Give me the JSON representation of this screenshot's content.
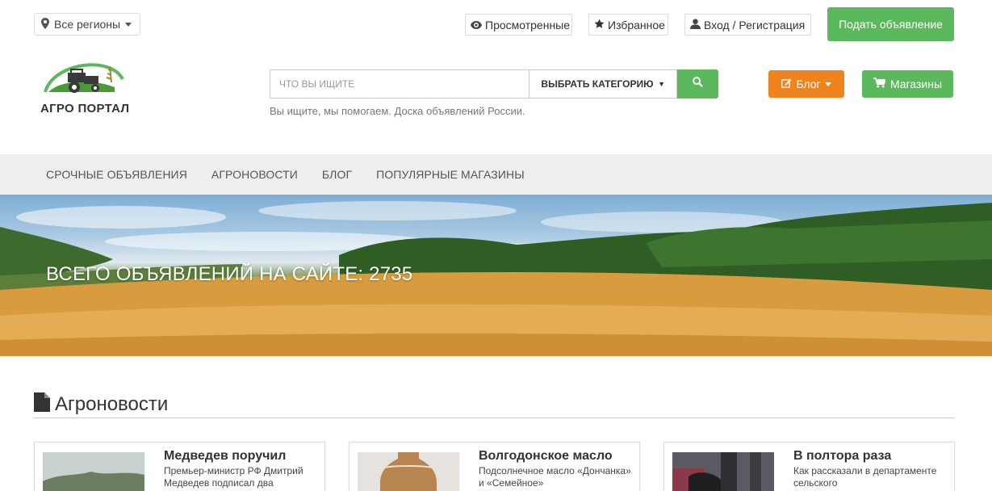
{
  "topbar": {
    "region_label": "Все регионы",
    "viewed_label": "Просмотренные",
    "favorites_label": "Избранное",
    "login_label": "Вход / Регистрация",
    "submit_ad_label": "Подать объявление"
  },
  "logo": {
    "text": "АГРО ПОРТАЛ"
  },
  "search": {
    "placeholder": "ЧТО ВЫ ИЩИТЕ",
    "category_label": "ВЫБРАТЬ КАТЕГОРИЮ",
    "tagline": "Вы ищите, мы помогаем. Доска объявлений России."
  },
  "buttons": {
    "blog_label": "Блог",
    "shops_label": "Магазины"
  },
  "nav": {
    "items": [
      {
        "label": "СРОЧНЫЕ ОБЪЯВЛЕНИЯ"
      },
      {
        "label": "АГРОНОВОСТИ"
      },
      {
        "label": "БЛОГ"
      },
      {
        "label": "ПОПУЛЯРНЫЕ МАГАЗИНЫ"
      }
    ]
  },
  "hero": {
    "title": "ВСЕГО ОБЪЯВЛЕНИЙ НА САЙТЕ: 2735"
  },
  "news": {
    "heading": "Агроновости",
    "cards": [
      {
        "title": "Медведев поручил",
        "excerpt": "Премьер-министр РФ Дмитрий Медведев подписал два"
      },
      {
        "title": "Волгодонское масло",
        "excerpt": "Подсолнечное масло «Дончанка» и «Семейное»"
      },
      {
        "title": "В полтора раза",
        "excerpt": "Как рассказали в департаменте сельского"
      }
    ]
  },
  "colors": {
    "green": "#5cb85c",
    "orange": "#f0841c"
  }
}
